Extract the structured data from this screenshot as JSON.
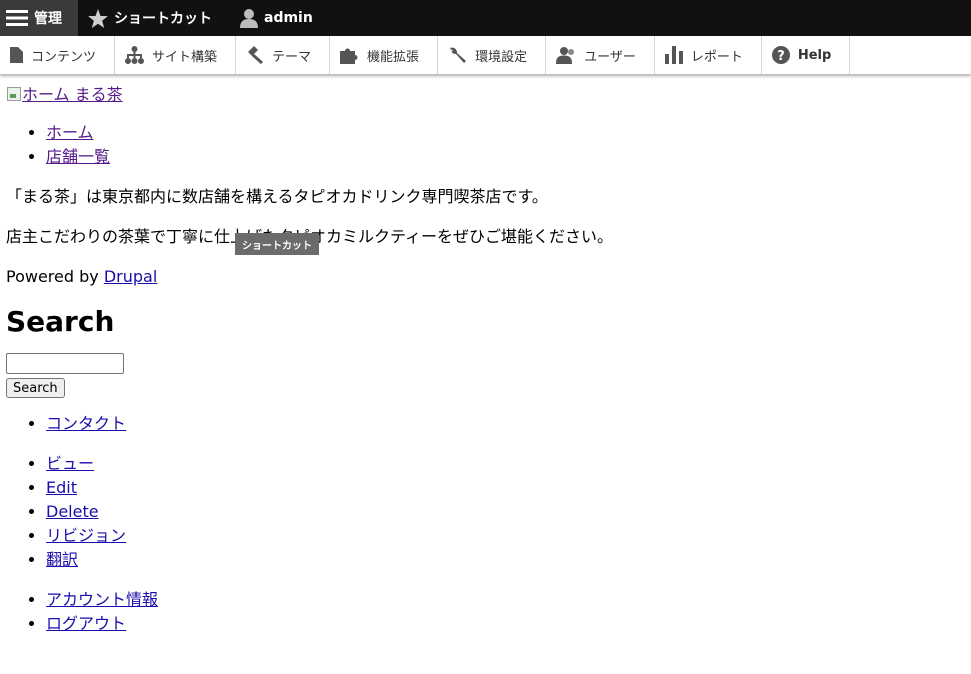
{
  "toolbar": {
    "manage_label": "管理",
    "shortcuts_label": "ショートカット",
    "user_label": "admin"
  },
  "tray": {
    "items": [
      {
        "label": "コンテンツ",
        "icon": "file-icon"
      },
      {
        "label": "サイト構築",
        "icon": "sitemap-icon"
      },
      {
        "label": "テーマ",
        "icon": "paintbrush-icon"
      },
      {
        "label": "機能拡張",
        "icon": "puzzle-icon"
      },
      {
        "label": "環境設定",
        "icon": "wrench-icon"
      },
      {
        "label": "ユーザー",
        "icon": "people-icon"
      },
      {
        "label": "レポート",
        "icon": "bar-chart-icon"
      },
      {
        "label": "Help",
        "icon": "help-icon"
      }
    ]
  },
  "site": {
    "logo_alt": "ホーム",
    "name": "まる茶",
    "main_nav": [
      "ホーム",
      "店舗一覧"
    ],
    "intro": "「まる茶」は東京都内に数店舗を構えるタピオカドリンク専門喫茶店です。",
    "intro2": "店主こだわりの茶葉で丁寧に仕上げたタピオカミルクティーをぜひご堪能ください。",
    "powered_prefix": "Powered by ",
    "powered_link": "Drupal"
  },
  "search": {
    "heading": "Search",
    "input_value": "",
    "button_label": "Search"
  },
  "footer_nav": [
    "コンタクト"
  ],
  "tabs": [
    "ビュー",
    "Edit",
    "Delete",
    "リビジョン",
    "翻訳"
  ],
  "account_menu": [
    "アカウント情報",
    "ログアウト"
  ],
  "tooltip": "ショートカット",
  "colors": {
    "topbar_bg": "#111111",
    "topbar_active": "#3a3a3a",
    "link": "#1a0dab",
    "visited": "#551a8b"
  }
}
